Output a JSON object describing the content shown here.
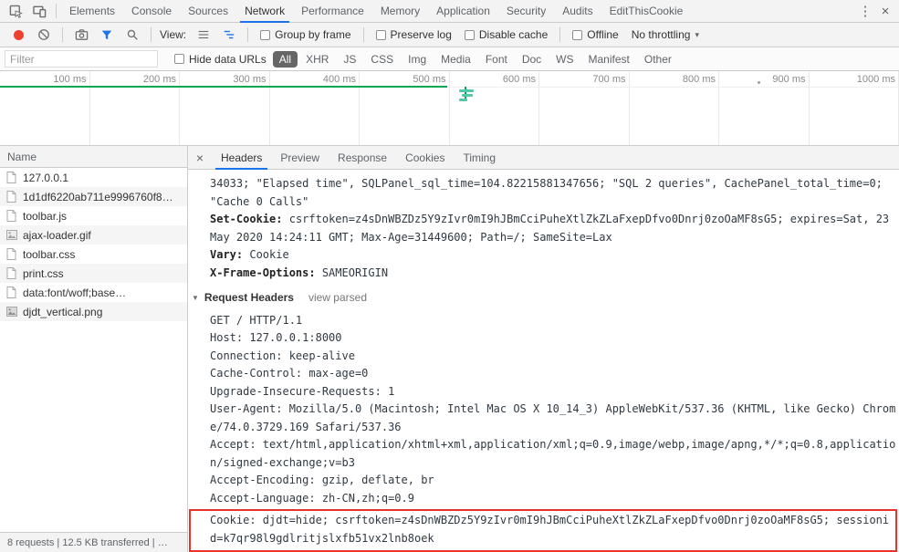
{
  "window": {
    "tabs": [
      {
        "label": "Elements"
      },
      {
        "label": "Console"
      },
      {
        "label": "Sources"
      },
      {
        "label": "Network"
      },
      {
        "label": "Performance"
      },
      {
        "label": "Memory"
      },
      {
        "label": "Application"
      },
      {
        "label": "Security"
      },
      {
        "label": "Audits"
      },
      {
        "label": "EditThisCookie"
      }
    ],
    "active_tab": "Network"
  },
  "icons": {
    "menu_icon": "⋮",
    "close_icon": "×",
    "detail_close_icon": "×",
    "dropdown_caret": "▾",
    "disclosure_triangle": "▼"
  },
  "toolbar": {
    "view_label": "View:",
    "group_by_frame": "Group by frame",
    "preserve_log": "Preserve log",
    "disable_cache": "Disable cache",
    "offline": "Offline",
    "throttling": "No throttling"
  },
  "filter_bar": {
    "filter_placeholder": "Filter",
    "hide_data_urls": "Hide data URLs",
    "active_type": "All",
    "types": [
      {
        "label": "All"
      },
      {
        "label": "XHR"
      },
      {
        "label": "JS"
      },
      {
        "label": "CSS"
      },
      {
        "label": "Img"
      },
      {
        "label": "Media"
      },
      {
        "label": "Font"
      },
      {
        "label": "Doc"
      },
      {
        "label": "WS"
      },
      {
        "label": "Manifest"
      },
      {
        "label": "Other"
      }
    ]
  },
  "timeline": {
    "tick_labels": [
      "100 ms",
      "200 ms",
      "300 ms",
      "400 ms",
      "500 ms",
      "600 ms",
      "700 ms",
      "800 ms",
      "900 ms",
      "1000 ms"
    ]
  },
  "request_list": {
    "column_header": "Name",
    "items": [
      {
        "name": "127.0.0.1",
        "icon": "document-icon"
      },
      {
        "name": "1d1df6220ab711e9996760f8…",
        "icon": "document-icon"
      },
      {
        "name": "toolbar.js",
        "icon": "script-icon"
      },
      {
        "name": "ajax-loader.gif",
        "icon": "image-icon"
      },
      {
        "name": "toolbar.css",
        "icon": "stylesheet-icon"
      },
      {
        "name": "print.css",
        "icon": "stylesheet-icon"
      },
      {
        "name": "data:font/woff;base…",
        "icon": "font-icon"
      },
      {
        "name": "djdt_vertical.png",
        "icon": "image-icon"
      }
    ]
  },
  "summary_bar": {
    "text": "8 requests | 12.5 KB transferred | …"
  },
  "details": {
    "active_tab": "Headers",
    "tabs": [
      {
        "label": "Headers"
      },
      {
        "label": "Preview"
      },
      {
        "label": "Response"
      },
      {
        "label": "Cookies"
      },
      {
        "label": "Timing"
      }
    ],
    "response_value_tail": "34033; \"Elapsed time\", SQLPanel_sql_time=104.82215881347656; \"SQL 2 queries\", CachePanel_total_time=0; \"Cache 0 Calls\"",
    "response_headers": [
      {
        "name": "Set-Cookie:",
        "value": "csrftoken=z4sDnWBZDz5Y9zIvr0mI9hJBmCciPuheXtlZkZLaFxepDfvo0Dnrj0zoOaMF8sG5; expires=Sat, 23 May 2020 14:24:11 GMT; Max-Age=31449600; Path=/; SameSite=Lax"
      },
      {
        "name": "Vary:",
        "value": "Cookie"
      },
      {
        "name": "X-Frame-Options:",
        "value": "SAMEORIGIN"
      }
    ],
    "request_headers_section": "Request Headers",
    "view_parsed_link": "view parsed",
    "request_raw": [
      "GET / HTTP/1.1",
      "Host: 127.0.0.1:8000",
      "Connection: keep-alive",
      "Cache-Control: max-age=0",
      "Upgrade-Insecure-Requests: 1",
      "User-Agent: Mozilla/5.0 (Macintosh; Intel Mac OS X 10_14_3) AppleWebKit/537.36 (KHTML, like Gecko) Chrome/74.0.3729.169 Safari/537.36",
      "Accept: text/html,application/xhtml+xml,application/xml;q=0.9,image/webp,image/apng,*/*;q=0.8,application/signed-exchange;v=b3",
      "Accept-Encoding: gzip, deflate, br",
      "Accept-Language: zh-CN,zh;q=0.9"
    ],
    "highlighted_header": "Cookie: djdt=hide; csrftoken=z4sDnWBZDz5Y9zIvr0mI9hJBmCciPuheXtlZkZLaFxepDfvo0Dnrj0zoOaMF8sG5; sessionid=k7qr98l9gdlritjslxfb51vx2lnb8oek"
  },
  "colors": {
    "accent_blue": "#1a73e8",
    "record_red": "#ee402e",
    "annotation_red": "#e8332a",
    "timeline_green": "#00a651",
    "waterfall_teal": "#54c7a8",
    "filter_active_bg": "#666666"
  }
}
